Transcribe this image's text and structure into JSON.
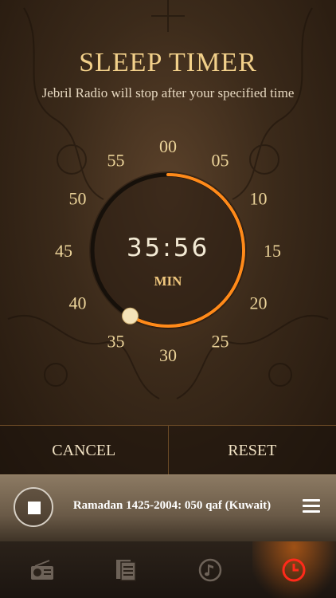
{
  "header": {
    "title": "SLEEP TIMER",
    "subtitle": "Jebril Radio will stop after your specified time"
  },
  "dial": {
    "minute_labels": [
      "00",
      "05",
      "10",
      "15",
      "20",
      "25",
      "30",
      "35",
      "40",
      "45",
      "50",
      "55"
    ],
    "selected_minutes": 35,
    "time_remaining": "35:56",
    "unit": "MIN",
    "accent_color": "#ff8a1a"
  },
  "actions": {
    "cancel_label": "CANCEL",
    "reset_label": "RESET"
  },
  "player": {
    "track_title": "Ramadan 1425-2004: 050 qaf (Kuwait)",
    "stop_icon": "stop-icon",
    "menu_icon": "menu-icon"
  },
  "tabbar": {
    "tabs": [
      {
        "icon": "radio-icon",
        "active": false
      },
      {
        "icon": "document-icon",
        "active": false
      },
      {
        "icon": "music-note-icon",
        "active": false
      },
      {
        "icon": "clock-icon",
        "active": true
      }
    ],
    "active_color": "#ff2a1a"
  }
}
